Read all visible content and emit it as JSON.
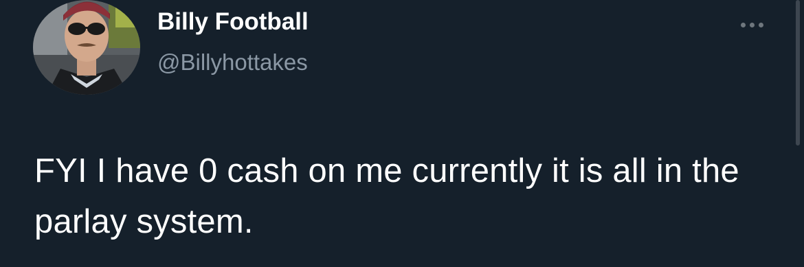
{
  "tweet": {
    "author": {
      "display_name": "Billy Football",
      "handle": "@Billyhottakes",
      "avatar_icon": "profile-photo"
    },
    "more_icon": "more-options-icon",
    "text": "FYI I have 0 cash on me currently it is all in the parlay system."
  },
  "colors": {
    "background": "#15202b",
    "text_primary": "#ffffff",
    "text_secondary": "#8b98a5",
    "icon_muted": "#6e767d"
  }
}
